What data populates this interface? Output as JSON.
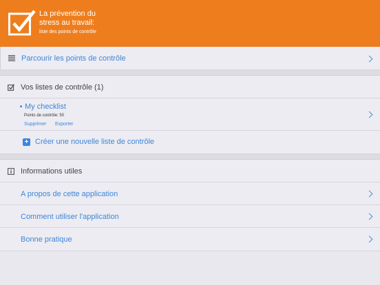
{
  "header": {
    "title_line1": "La prévention du",
    "title_line2": "stress au travail:",
    "subtitle": "liste des points de contrôle",
    "accent": "#ee7e1d"
  },
  "browse": {
    "label": "Parcourir les points de contrôle",
    "icon": "list-icon"
  },
  "lists": {
    "heading": "Vos listes de contrôle (1)",
    "icon": "checkbox-icon",
    "items": [
      {
        "name": "My checklist",
        "meta": "Points de contrôle: 50",
        "delete_label": "Supprimer",
        "export_label": "Exporter"
      }
    ],
    "create_label": "Créer une nouvelle liste de contrôle"
  },
  "info": {
    "heading": "Informations utiles",
    "icon": "info-icon",
    "items": [
      {
        "label": "A propos de cette application"
      },
      {
        "label": "Comment utiliser l'application"
      },
      {
        "label": "Bonne pratique"
      }
    ]
  },
  "colors": {
    "link": "#3f86d8",
    "plus": "#3a86e0"
  }
}
